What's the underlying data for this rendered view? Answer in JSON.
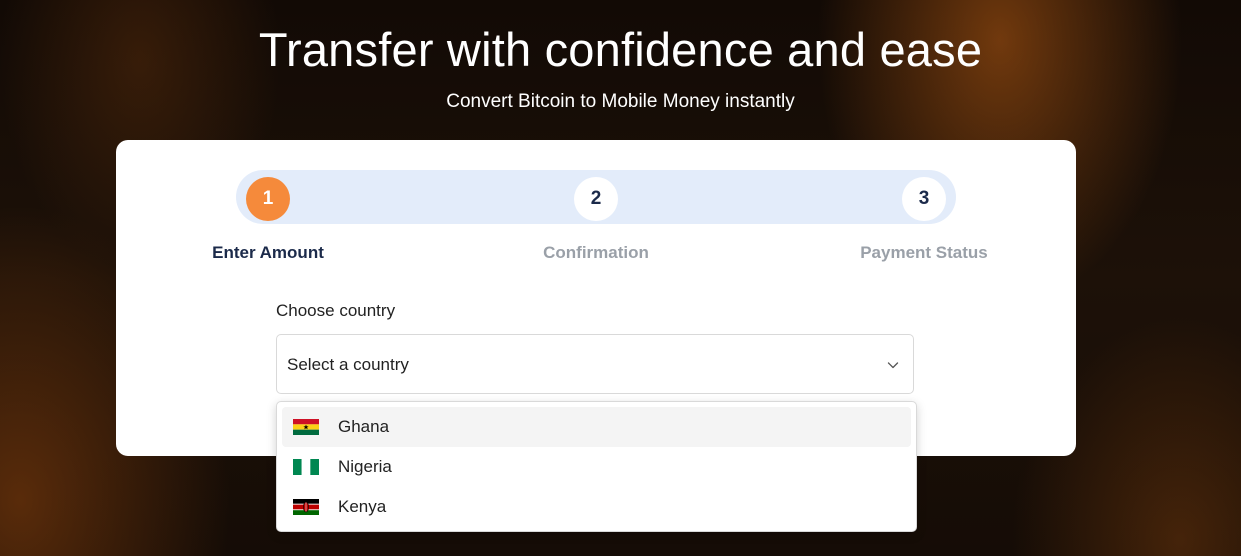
{
  "hero": {
    "title": "Transfer with confidence and ease",
    "subtitle": "Convert Bitcoin to Mobile Money instantly"
  },
  "stepper": {
    "steps": [
      {
        "number": "1",
        "label": "Enter Amount",
        "state": "active"
      },
      {
        "number": "2",
        "label": "Confirmation",
        "state": "inactive"
      },
      {
        "number": "3",
        "label": "Payment Status",
        "state": "inactive"
      }
    ]
  },
  "form": {
    "country_label": "Choose country",
    "country_select": {
      "placeholder": "Select a country",
      "icon": "chevron-down-icon",
      "options": [
        {
          "label": "Ghana",
          "flag": "ghana-flag-icon",
          "highlighted": true
        },
        {
          "label": "Nigeria",
          "flag": "nigeria-flag-icon",
          "highlighted": false
        },
        {
          "label": "Kenya",
          "flag": "kenya-flag-icon",
          "highlighted": false
        }
      ]
    }
  },
  "colors": {
    "accent": "#f58a3b",
    "step_track": "#e3ecfa",
    "text_dark": "#1b2a4a",
    "text_muted": "#9aa0a8"
  }
}
